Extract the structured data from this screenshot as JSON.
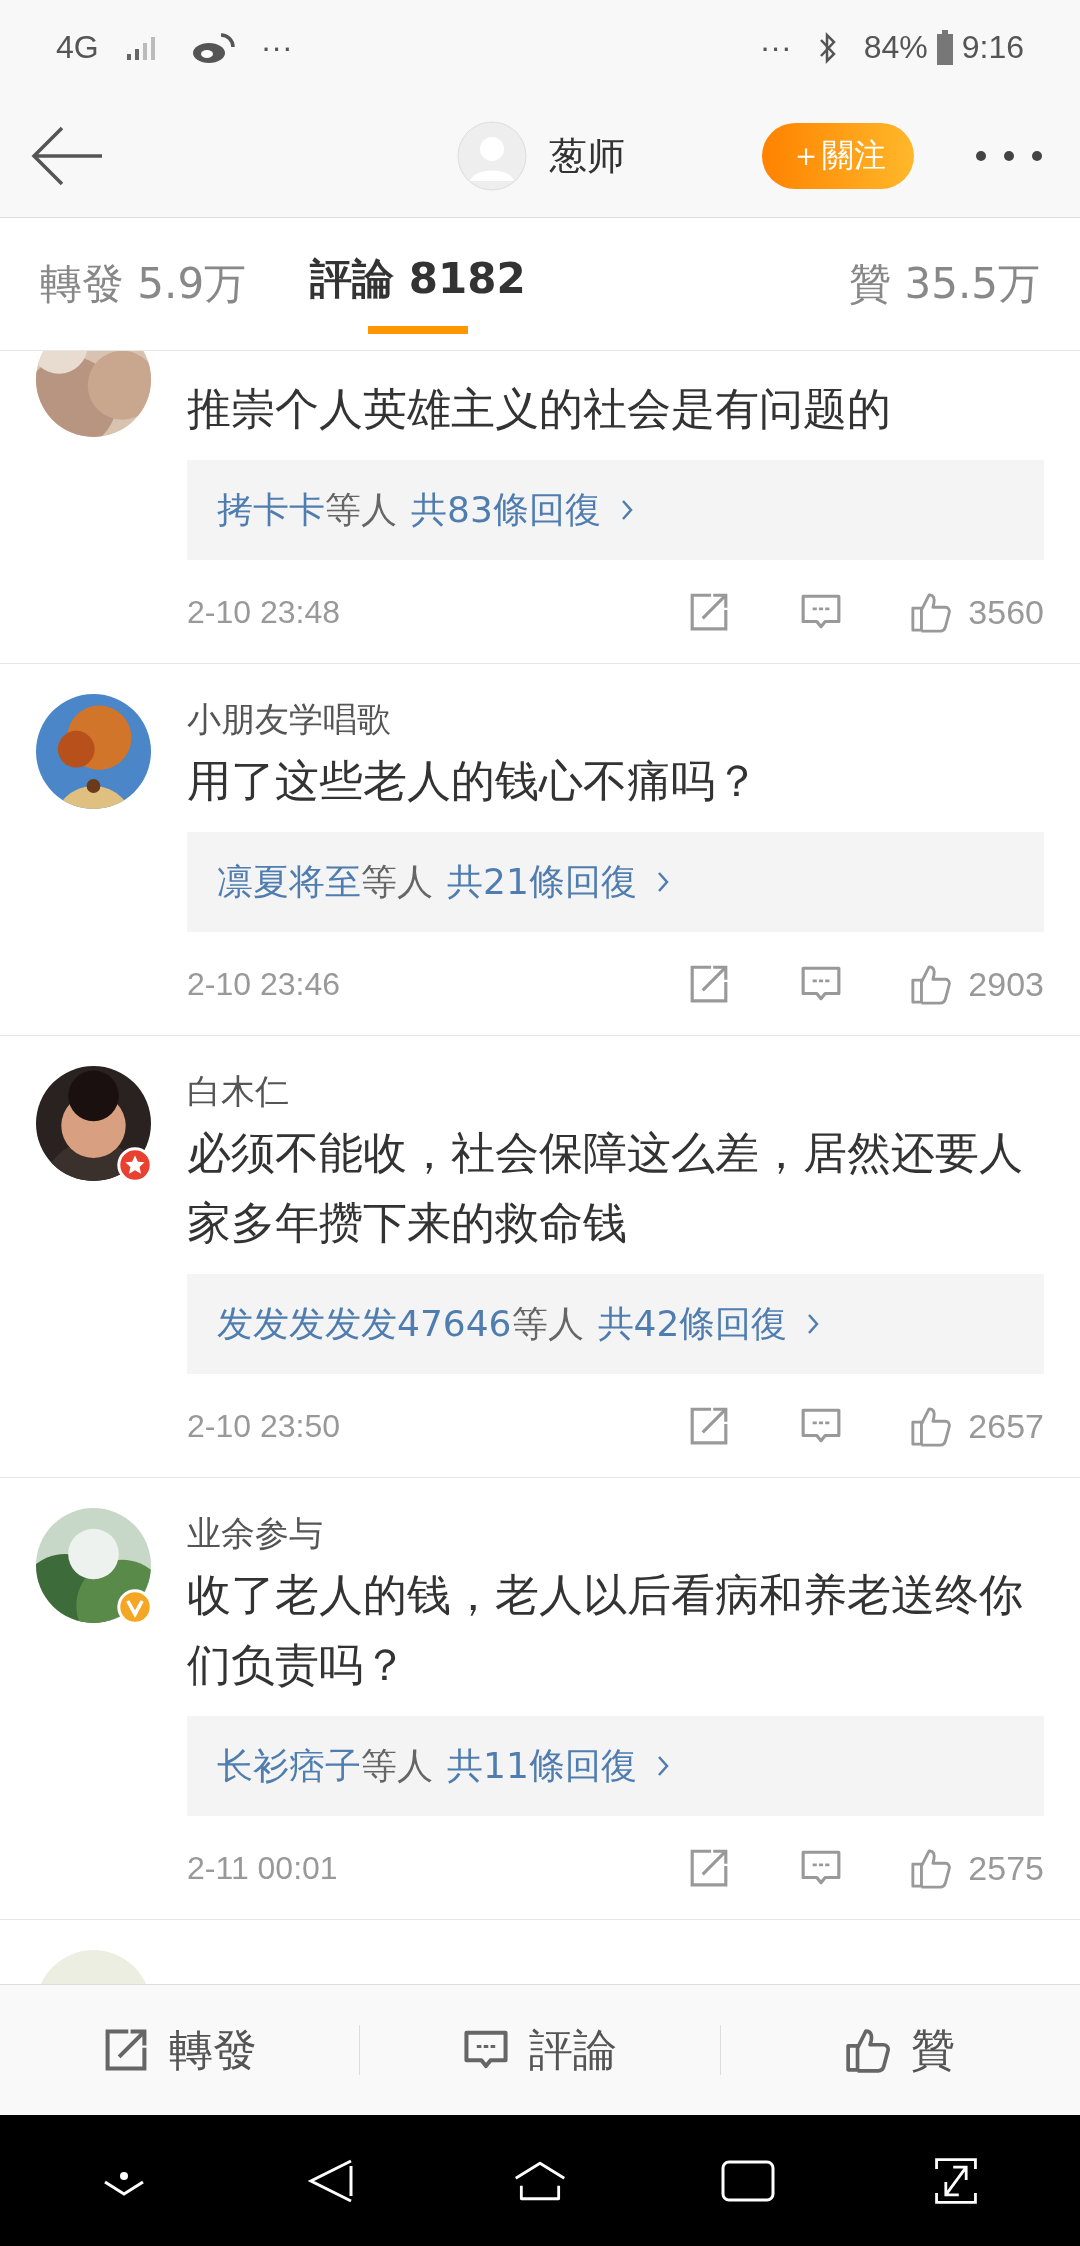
{
  "status_bar": {
    "network": "4G",
    "left_more": "···",
    "right_more": "···",
    "battery": "84%",
    "time": "9:16"
  },
  "header": {
    "user": "葱师",
    "follow_button": "＋關注"
  },
  "tabs": [
    {
      "label": "轉發",
      "count": "5.9万",
      "selected": false
    },
    {
      "label": "評論",
      "count": "8182",
      "selected": true
    },
    {
      "label": "贊",
      "count": "35.5万",
      "selected": false
    }
  ],
  "comments": [
    {
      "text": "推崇个人英雄主义的社会是有问题的",
      "reply": {
        "users": "拷卡卡",
        "suffix": "等人",
        "count": "共83條回復"
      },
      "time": "2-10 23:48",
      "likes": "3560"
    },
    {
      "name": "小朋友学唱歌",
      "text": "用了这些老人的钱心不痛吗？",
      "reply": {
        "users": "凛夏将至",
        "suffix": "等人",
        "count": "共21條回復"
      },
      "time": "2-10 23:46",
      "likes": "2903"
    },
    {
      "name": "白木仁",
      "badge": {
        "kind": "star",
        "color": "#e8412f"
      },
      "text": "必须不能收，社会保障这么差，居然还要人家多年攒下来的救命钱",
      "reply": {
        "users": "发发发发发47646",
        "suffix": "等人",
        "count": "共42條回復"
      },
      "time": "2-10 23:50",
      "likes": "2657"
    },
    {
      "name": "业余参与",
      "badge": {
        "kind": "verified",
        "color": "#f5a623"
      },
      "text": "收了老人的钱，老人以后看病和养老送终你们负责吗？",
      "reply": {
        "users": "长衫痞子",
        "suffix": "等人",
        "count": "共11條回復"
      },
      "time": "2-11 00:01",
      "likes": "2575"
    }
  ],
  "bottom_bar": [
    {
      "kind": "repost",
      "label": "轉發"
    },
    {
      "kind": "comment",
      "label": "評論"
    },
    {
      "kind": "like",
      "label": "贊"
    }
  ]
}
